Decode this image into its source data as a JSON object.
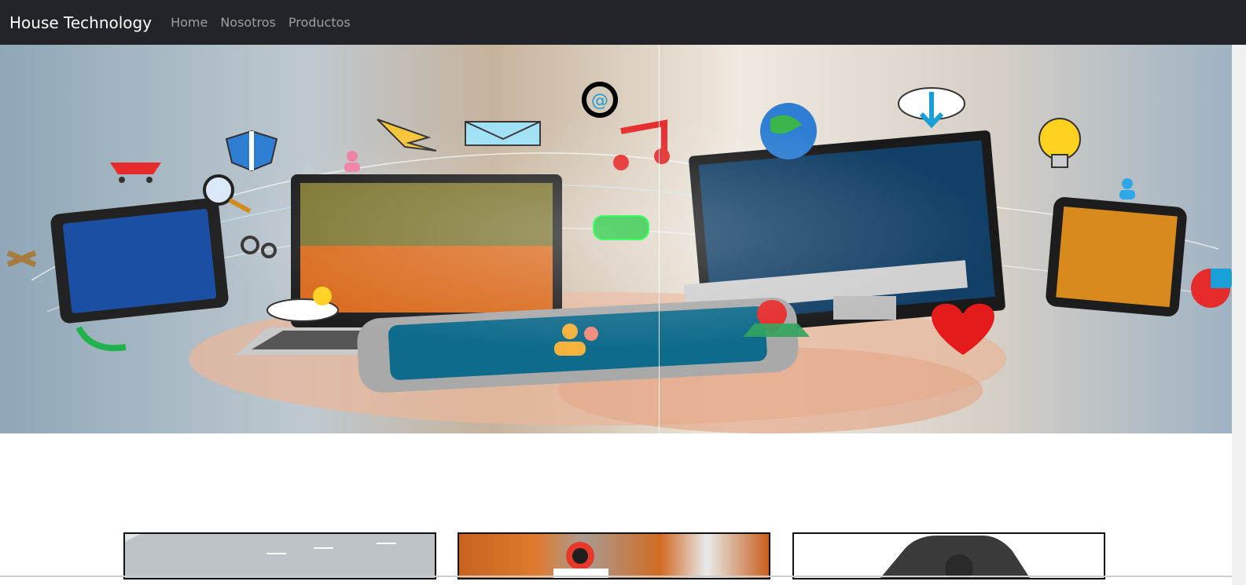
{
  "navbar": {
    "brand": "House Technology",
    "links": [
      "Home",
      "Nosotros",
      "Productos"
    ]
  },
  "colors": {
    "navbar_bg": "#212529",
    "brand_text": "#ffffff",
    "link_text": "rgba(255,255,255,0.55)"
  },
  "hero": {
    "icon_names": [
      "tablet-icon",
      "laptop-icon",
      "monitor-icon",
      "smartphone-icon",
      "tablet-phone-icon",
      "email-icon",
      "at-icon",
      "music-icon",
      "cart-icon",
      "search-icon",
      "cloud-download-icon",
      "globe-icon",
      "lightbulb-icon",
      "chat-icon",
      "gear-icon",
      "phone-icon",
      "location-icon",
      "heart-icon",
      "users-icon",
      "weather-icon"
    ]
  },
  "products": {
    "cards": [
      {
        "icon": "road-image-icon"
      },
      {
        "icon": "motorcycle-rider-image-icon"
      },
      {
        "icon": "device-image-icon"
      }
    ]
  }
}
